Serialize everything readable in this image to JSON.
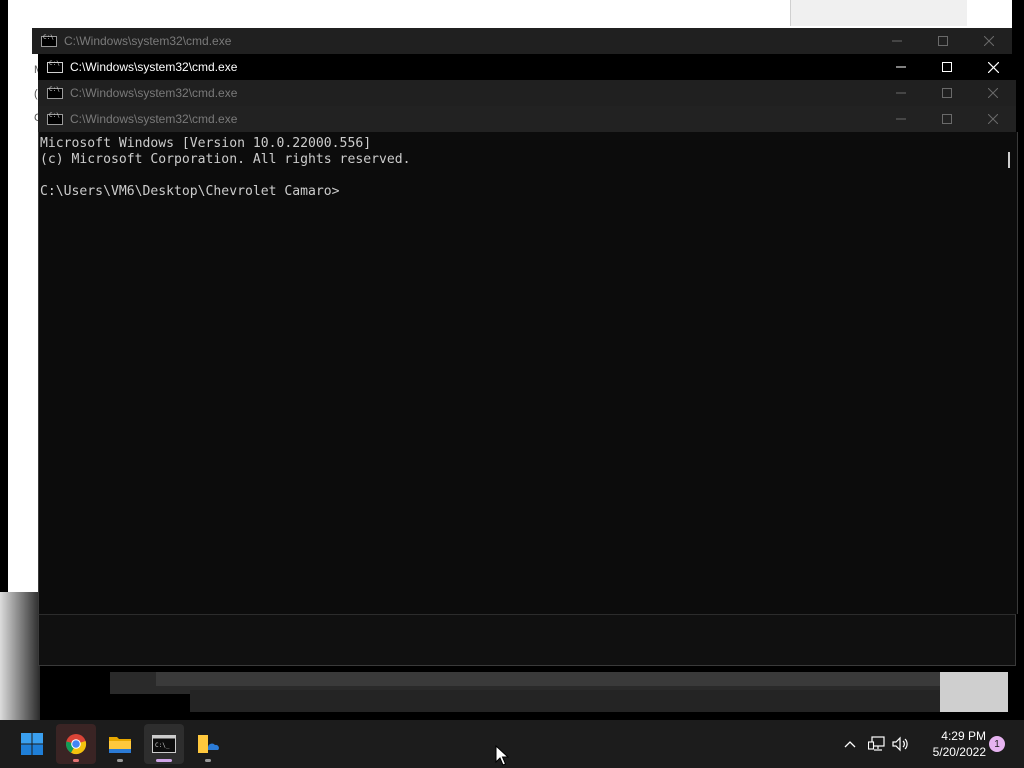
{
  "windows": [
    {
      "title": "C:\\Windows\\system32\\cmd.exe",
      "active": false
    },
    {
      "title": "C:\\Windows\\system32\\cmd.exe",
      "active": true
    },
    {
      "title": "C:\\Windows\\system32\\cmd.exe",
      "active": false
    },
    {
      "title": "C:\\Windows\\system32\\cmd.exe",
      "active": false
    }
  ],
  "console": {
    "lines": [
      "Microsoft Windows [Version 10.0.22000.556]",
      "(c) Microsoft Corporation. All rights reserved.",
      "",
      "C:\\Users\\VM6\\Desktop\\Chevrolet Camaro>"
    ]
  },
  "background_letters": [
    "M",
    "(",
    "C"
  ],
  "taskbar": {
    "apps": [
      {
        "name": "Start",
        "icon": "windows-logo-icon"
      },
      {
        "name": "Google Chrome",
        "icon": "chrome-icon"
      },
      {
        "name": "File Explorer",
        "icon": "folder-icon"
      },
      {
        "name": "Command Prompt",
        "icon": "terminal-icon"
      },
      {
        "name": "OneDrive folder",
        "icon": "onedrive-folder-icon"
      }
    ],
    "time": "4:29 PM",
    "date": "5/20/2022",
    "notification_count": "1"
  },
  "colors": {
    "console_bg": "#0c0c0c",
    "console_text": "#cccccc",
    "taskbar_bg": "#1c1c1c",
    "accent": "#0078d4"
  }
}
